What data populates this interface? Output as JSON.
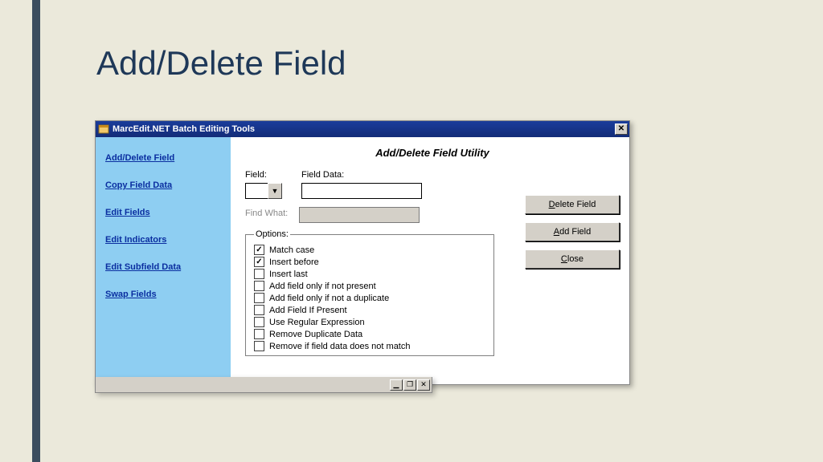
{
  "page": {
    "title": "Add/Delete Field"
  },
  "window": {
    "title": "MarcEdit.NET Batch Editing Tools",
    "utility_title": "Add/Delete Field Utility"
  },
  "sidebar": {
    "items": [
      {
        "label": "Add/Delete Field"
      },
      {
        "label": "Copy Field Data"
      },
      {
        "label": "Edit Fields"
      },
      {
        "label": "Edit Indicators"
      },
      {
        "label": "Edit Subfield Data"
      },
      {
        "label": "Swap Fields"
      }
    ]
  },
  "form": {
    "field_label": "Field:",
    "field_value": "",
    "fielddata_label": "Field Data:",
    "fielddata_value": "",
    "findwhat_label": "Find What:",
    "findwhat_value": "",
    "options_legend": "Options:",
    "options": [
      {
        "label": "Match case",
        "checked": true
      },
      {
        "label": "Insert before",
        "checked": true
      },
      {
        "label": "Insert last",
        "checked": false
      },
      {
        "label": "Add field only if not present",
        "checked": false
      },
      {
        "label": "Add field only if not a duplicate",
        "checked": false
      },
      {
        "label": "Add Field If Present",
        "checked": false
      },
      {
        "label": "Use Regular Expression",
        "checked": false
      },
      {
        "label": "Remove Duplicate Data",
        "checked": false
      },
      {
        "label": "Remove if field data does not match",
        "checked": false
      }
    ]
  },
  "buttons": {
    "delete_pre": "",
    "delete_accel": "D",
    "delete_post": "elete Field",
    "add_pre": "",
    "add_accel": "A",
    "add_post": "dd Field",
    "close_pre": "",
    "close_accel": "C",
    "close_post": "lose"
  }
}
